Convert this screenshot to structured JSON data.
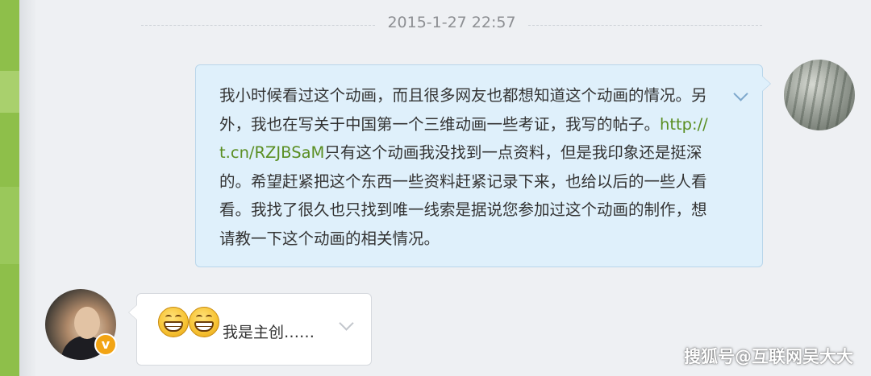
{
  "chat": {
    "timestamp": "2015-1-27 22:57",
    "outgoing": {
      "text_before_link": "我小时候看过这个动画，而且很多网友也都想知道这个动画的情况。另外，我也在写关于中国第一个三维动画一些考证，我写的帖子。",
      "link": "http://t.cn/RZJBSaM",
      "text_after_link": "只有这个动画我没找到一点资料，但是我印象还是挺深的。希望赶紧把这个东西一些资料赶紧记录下来，也给以后的一些人看看。我找了很久也只找到唯一线索是据说您参加过这个动画的制作，想请教一下这个动画的相关情况。"
    },
    "incoming": {
      "emojis": [
        "grin-emoji",
        "grin-emoji"
      ],
      "text": "我是主创……",
      "badge": "v"
    }
  },
  "watermark": "搜狐号@互联网吴大大",
  "colors": {
    "sidebar": "#8ebf4a",
    "outgoing_bubble": "#dff0fb",
    "incoming_bubble": "#ffffff",
    "link": "#5a8e22",
    "verified_badge": "#f2a414"
  }
}
